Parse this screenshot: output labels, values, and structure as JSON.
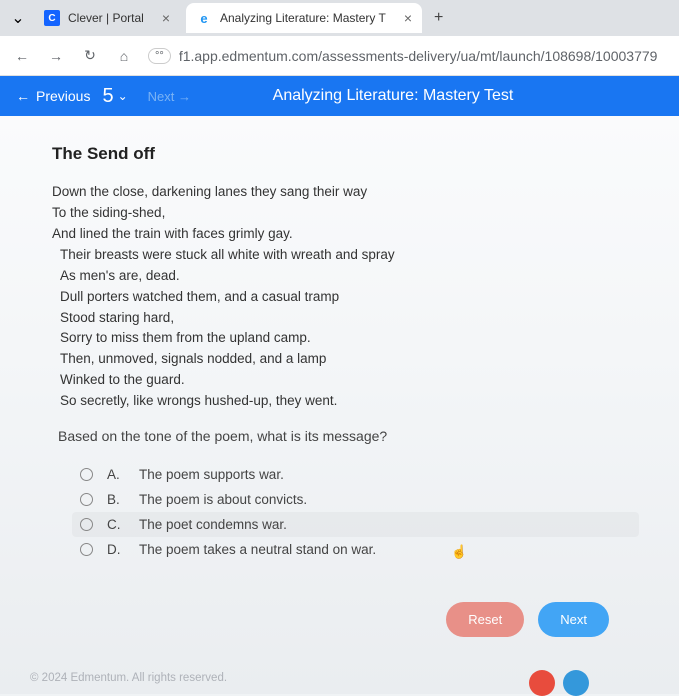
{
  "tabs": {
    "t0": {
      "title": "Clever | Portal",
      "favicon": "C"
    },
    "t1": {
      "title": "Analyzing Literature: Mastery T",
      "favicon": "e"
    }
  },
  "url": "f1.app.edmentum.com/assessments-delivery/ua/mt/launch/108698/10003779",
  "appHeader": {
    "previous": "Previous",
    "qnum": "5",
    "next": "Next",
    "title": "Analyzing Literature: Mastery Test"
  },
  "poem": {
    "title": "The Send off",
    "lines": [
      "Down the close, darkening lanes they sang their way",
      "To the siding-shed,",
      "And lined the train with faces grimly gay.",
      "Their breasts were stuck all white with wreath and spray",
      "As men's are, dead.",
      "Dull porters watched them, and a casual tramp",
      "Stood staring hard,",
      "Sorry to miss them from the upland camp.",
      "Then, unmoved, signals nodded, and a lamp",
      "Winked to the guard.",
      "So secretly, like wrongs hushed-up, they went."
    ]
  },
  "question": "Based on the tone of the poem, what is its message?",
  "options": {
    "a": {
      "letter": "A.",
      "text": "The poem supports war."
    },
    "b": {
      "letter": "B.",
      "text": "The poem is about convicts."
    },
    "c": {
      "letter": "C.",
      "text": "The poet condemns war."
    },
    "d": {
      "letter": "D.",
      "text": "The poem takes a neutral stand on war."
    }
  },
  "buttons": {
    "reset": "Reset",
    "next": "Next"
  },
  "footer": "© 2024 Edmentum. All rights reserved."
}
